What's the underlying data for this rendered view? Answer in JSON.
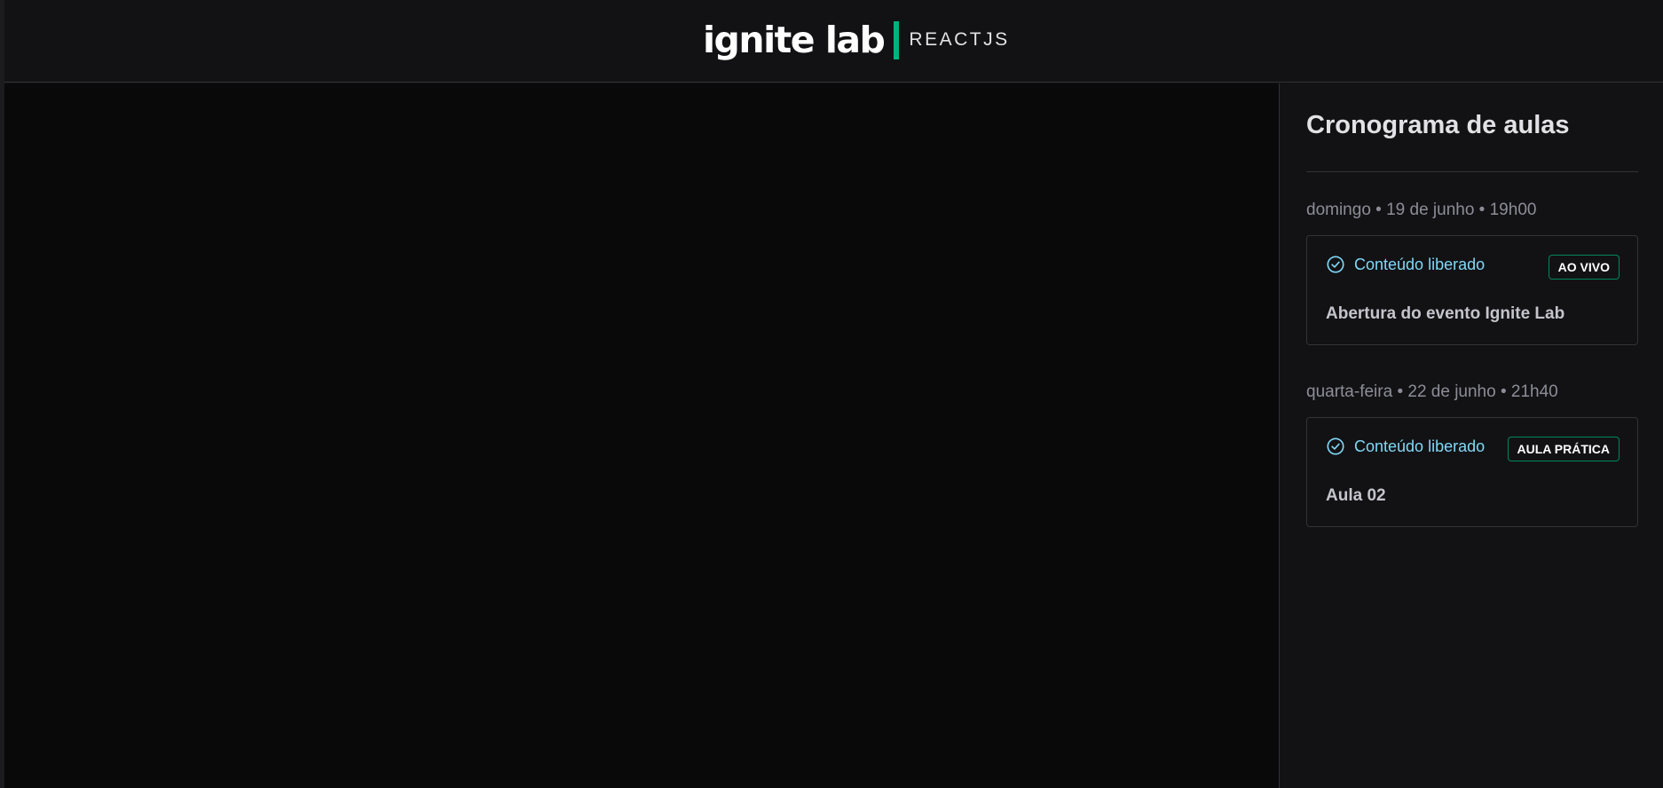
{
  "header": {
    "logo_text": "ignite lab",
    "logo_tag": "REACTJS"
  },
  "sidebar": {
    "title": "Cronograma de aulas",
    "lessons": [
      {
        "date": "domingo • 19 de junho • 19h00",
        "status": "Conteúdo liberado",
        "badge": "AO VIVO",
        "title": "Abertura do evento Ignite Lab"
      },
      {
        "date": "quarta-feira • 22 de junho • 21h40",
        "status": "Conteúdo liberado",
        "badge": "AULA PRÁTICA",
        "title": "Aula 02"
      }
    ]
  },
  "icons": {
    "status_icon": "check-circle-icon"
  },
  "colors": {
    "background": "#121214",
    "video_background": "#09090a",
    "accent_green": "#00b37e",
    "badge_border": "#00875f",
    "status_blue": "#81d8f7",
    "border": "#323238",
    "muted_text": "#8d8d99"
  }
}
